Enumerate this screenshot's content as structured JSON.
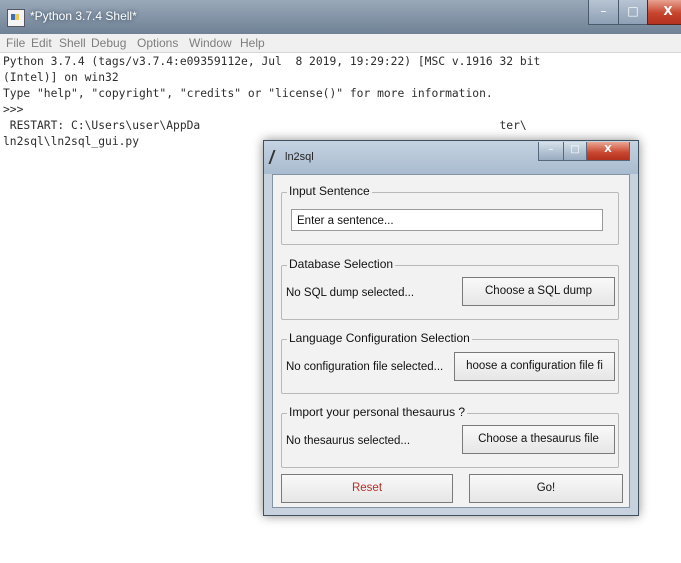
{
  "shell": {
    "title": "*Python 3.7.4 Shell*",
    "window_controls": {
      "minimize": "–",
      "maximize": "□",
      "close": "X"
    },
    "menu": [
      "File",
      "Edit",
      "Shell",
      "Debug",
      "Options",
      "Window",
      "Help"
    ],
    "output": "Python 3.7.4 (tags/v3.7.4:e09359112e, Jul  8 2019, 19:29:22) [MSC v.1916 32 bit\n(Intel)] on win32\nType \"help\", \"copyright\", \"credits\" or \"license()\" for more information.\n>>>\n RESTART: C:\\Users\\user\\AppDa                                            ter\\\nln2sql\\ln2sql_gui.py"
  },
  "dialog": {
    "title": "ln2sql",
    "window_controls": {
      "minimize": "–",
      "maximize": "□",
      "close": "X"
    },
    "input_group": {
      "label": "Input Sentence",
      "placeholder": "Enter a sentence..."
    },
    "database_group": {
      "label": "Database Selection",
      "status": "No SQL dump selected...",
      "button": "Choose a SQL dump"
    },
    "language_group": {
      "label": "Language Configuration Selection",
      "status": "No configuration file selected...",
      "button": "hoose a configuration file fi"
    },
    "thesaurus_group": {
      "label": "Import your personal thesaurus ?",
      "status": "No thesaurus selected...",
      "button": "Choose a thesaurus file"
    },
    "reset_button": "Reset",
    "go_button": "Go!"
  }
}
